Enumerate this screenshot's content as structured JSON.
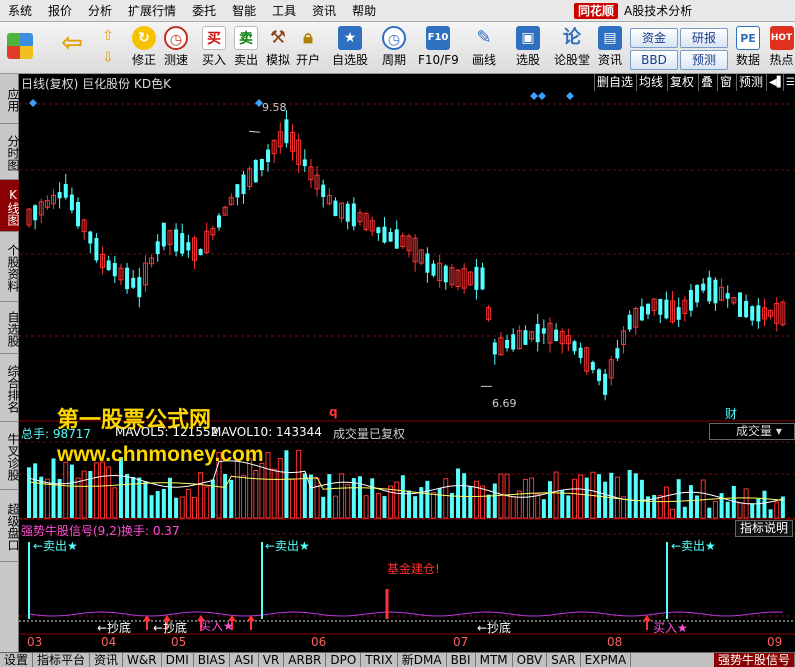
{
  "menu": {
    "items": [
      "系统",
      "报价",
      "分析",
      "扩展行情",
      "委托",
      "智能",
      "工具",
      "资讯",
      "帮助"
    ],
    "brand": "同花顺",
    "app_title": "A股技术分析"
  },
  "toolbar": {
    "buttons": [
      {
        "name": "back",
        "label": ""
      },
      {
        "name": "revise",
        "label": "修正"
      },
      {
        "name": "test",
        "label": "测速"
      },
      {
        "name": "buy",
        "label": "买入",
        "glyph": "买"
      },
      {
        "name": "sell",
        "label": "卖出",
        "glyph": "卖"
      },
      {
        "name": "simulate",
        "label": "模拟"
      },
      {
        "name": "open-account",
        "label": "开户"
      },
      {
        "name": "self-select",
        "label": "自选股"
      },
      {
        "name": "period",
        "label": "周期"
      },
      {
        "name": "f10",
        "label": "F10/F9"
      },
      {
        "name": "draw-line",
        "label": "画线"
      },
      {
        "name": "stock-pick",
        "label": "选股"
      },
      {
        "name": "forum",
        "label": "论股堂",
        "glyph": "论"
      },
      {
        "name": "news",
        "label": "资讯"
      },
      {
        "name": "data",
        "label": "数据",
        "glyph": "PE"
      },
      {
        "name": "hot",
        "label": "热点"
      }
    ],
    "small_buttons": [
      "资金",
      "研报",
      "BBD",
      "预测"
    ]
  },
  "left_tabs": [
    {
      "label": "应用",
      "active": false
    },
    {
      "label": "分时图",
      "active": false
    },
    {
      "label": "K线图",
      "active": true
    },
    {
      "label": "个股资料",
      "active": false
    },
    {
      "label": "自选股",
      "active": false
    },
    {
      "label": "综合排名",
      "active": false
    },
    {
      "label": "牛叉诊股",
      "active": false
    },
    {
      "label": "超级盘口",
      "active": false
    }
  ],
  "main_chart": {
    "title": "日线(复权) 巨化股份 KD色K",
    "controls": [
      "删自选",
      "均线",
      "复权",
      "叠",
      "窗",
      "预测"
    ],
    "high_label": "9.58",
    "low_label": "6.69",
    "marker_q": "q",
    "marker_cai": "财"
  },
  "volume_panel": {
    "total_label": "总手: 98717",
    "mavol5_label": "MAVOL5: 121552",
    "mavol10_label": "MAVOL10: 143344",
    "note": "成交量已复权",
    "selector": "成交量"
  },
  "indicator_panel": {
    "title": "强势牛股信号(9,2)",
    "turnover": "换手: 0.37",
    "explain_button": "指标说明",
    "sell_label": "卖出★",
    "base_label": "基金建仓!",
    "bottom_label": "抄底",
    "buy_label": "买入"
  },
  "x_axis": [
    "03",
    "04",
    "05",
    "06",
    "07",
    "08",
    "09"
  ],
  "watermark": {
    "title": "第一股票公式网",
    "url": "www.chnmoney.com"
  },
  "bottom_tabs": [
    {
      "label": "设置",
      "active": false
    },
    {
      "label": "指标平台",
      "active": false
    },
    {
      "label": "资讯",
      "active": false
    },
    {
      "label": "W&R",
      "active": false
    },
    {
      "label": "DMI",
      "active": false
    },
    {
      "label": "BIAS",
      "active": false
    },
    {
      "label": "ASI",
      "active": false
    },
    {
      "label": "VR",
      "active": false
    },
    {
      "label": "ARBR",
      "active": false
    },
    {
      "label": "DPO",
      "active": false
    },
    {
      "label": "TRIX",
      "active": false
    },
    {
      "label": "新DMA",
      "active": false
    },
    {
      "label": "BBI",
      "active": false
    },
    {
      "label": "MTM",
      "active": false
    },
    {
      "label": "OBV",
      "active": false
    },
    {
      "label": "SAR",
      "active": false
    },
    {
      "label": "EXPMA",
      "active": false
    },
    {
      "label": "强势牛股信号",
      "active": true
    }
  ],
  "colors": {
    "up": "#ff3232",
    "down": "#54ffff",
    "grid": "#8b0000",
    "ma": "#ffffff",
    "diamond": "#3ca0ff",
    "indicator_line": "#b43cdc",
    "signal_text": "#54ffff",
    "buy": "#ff4fd8"
  }
}
